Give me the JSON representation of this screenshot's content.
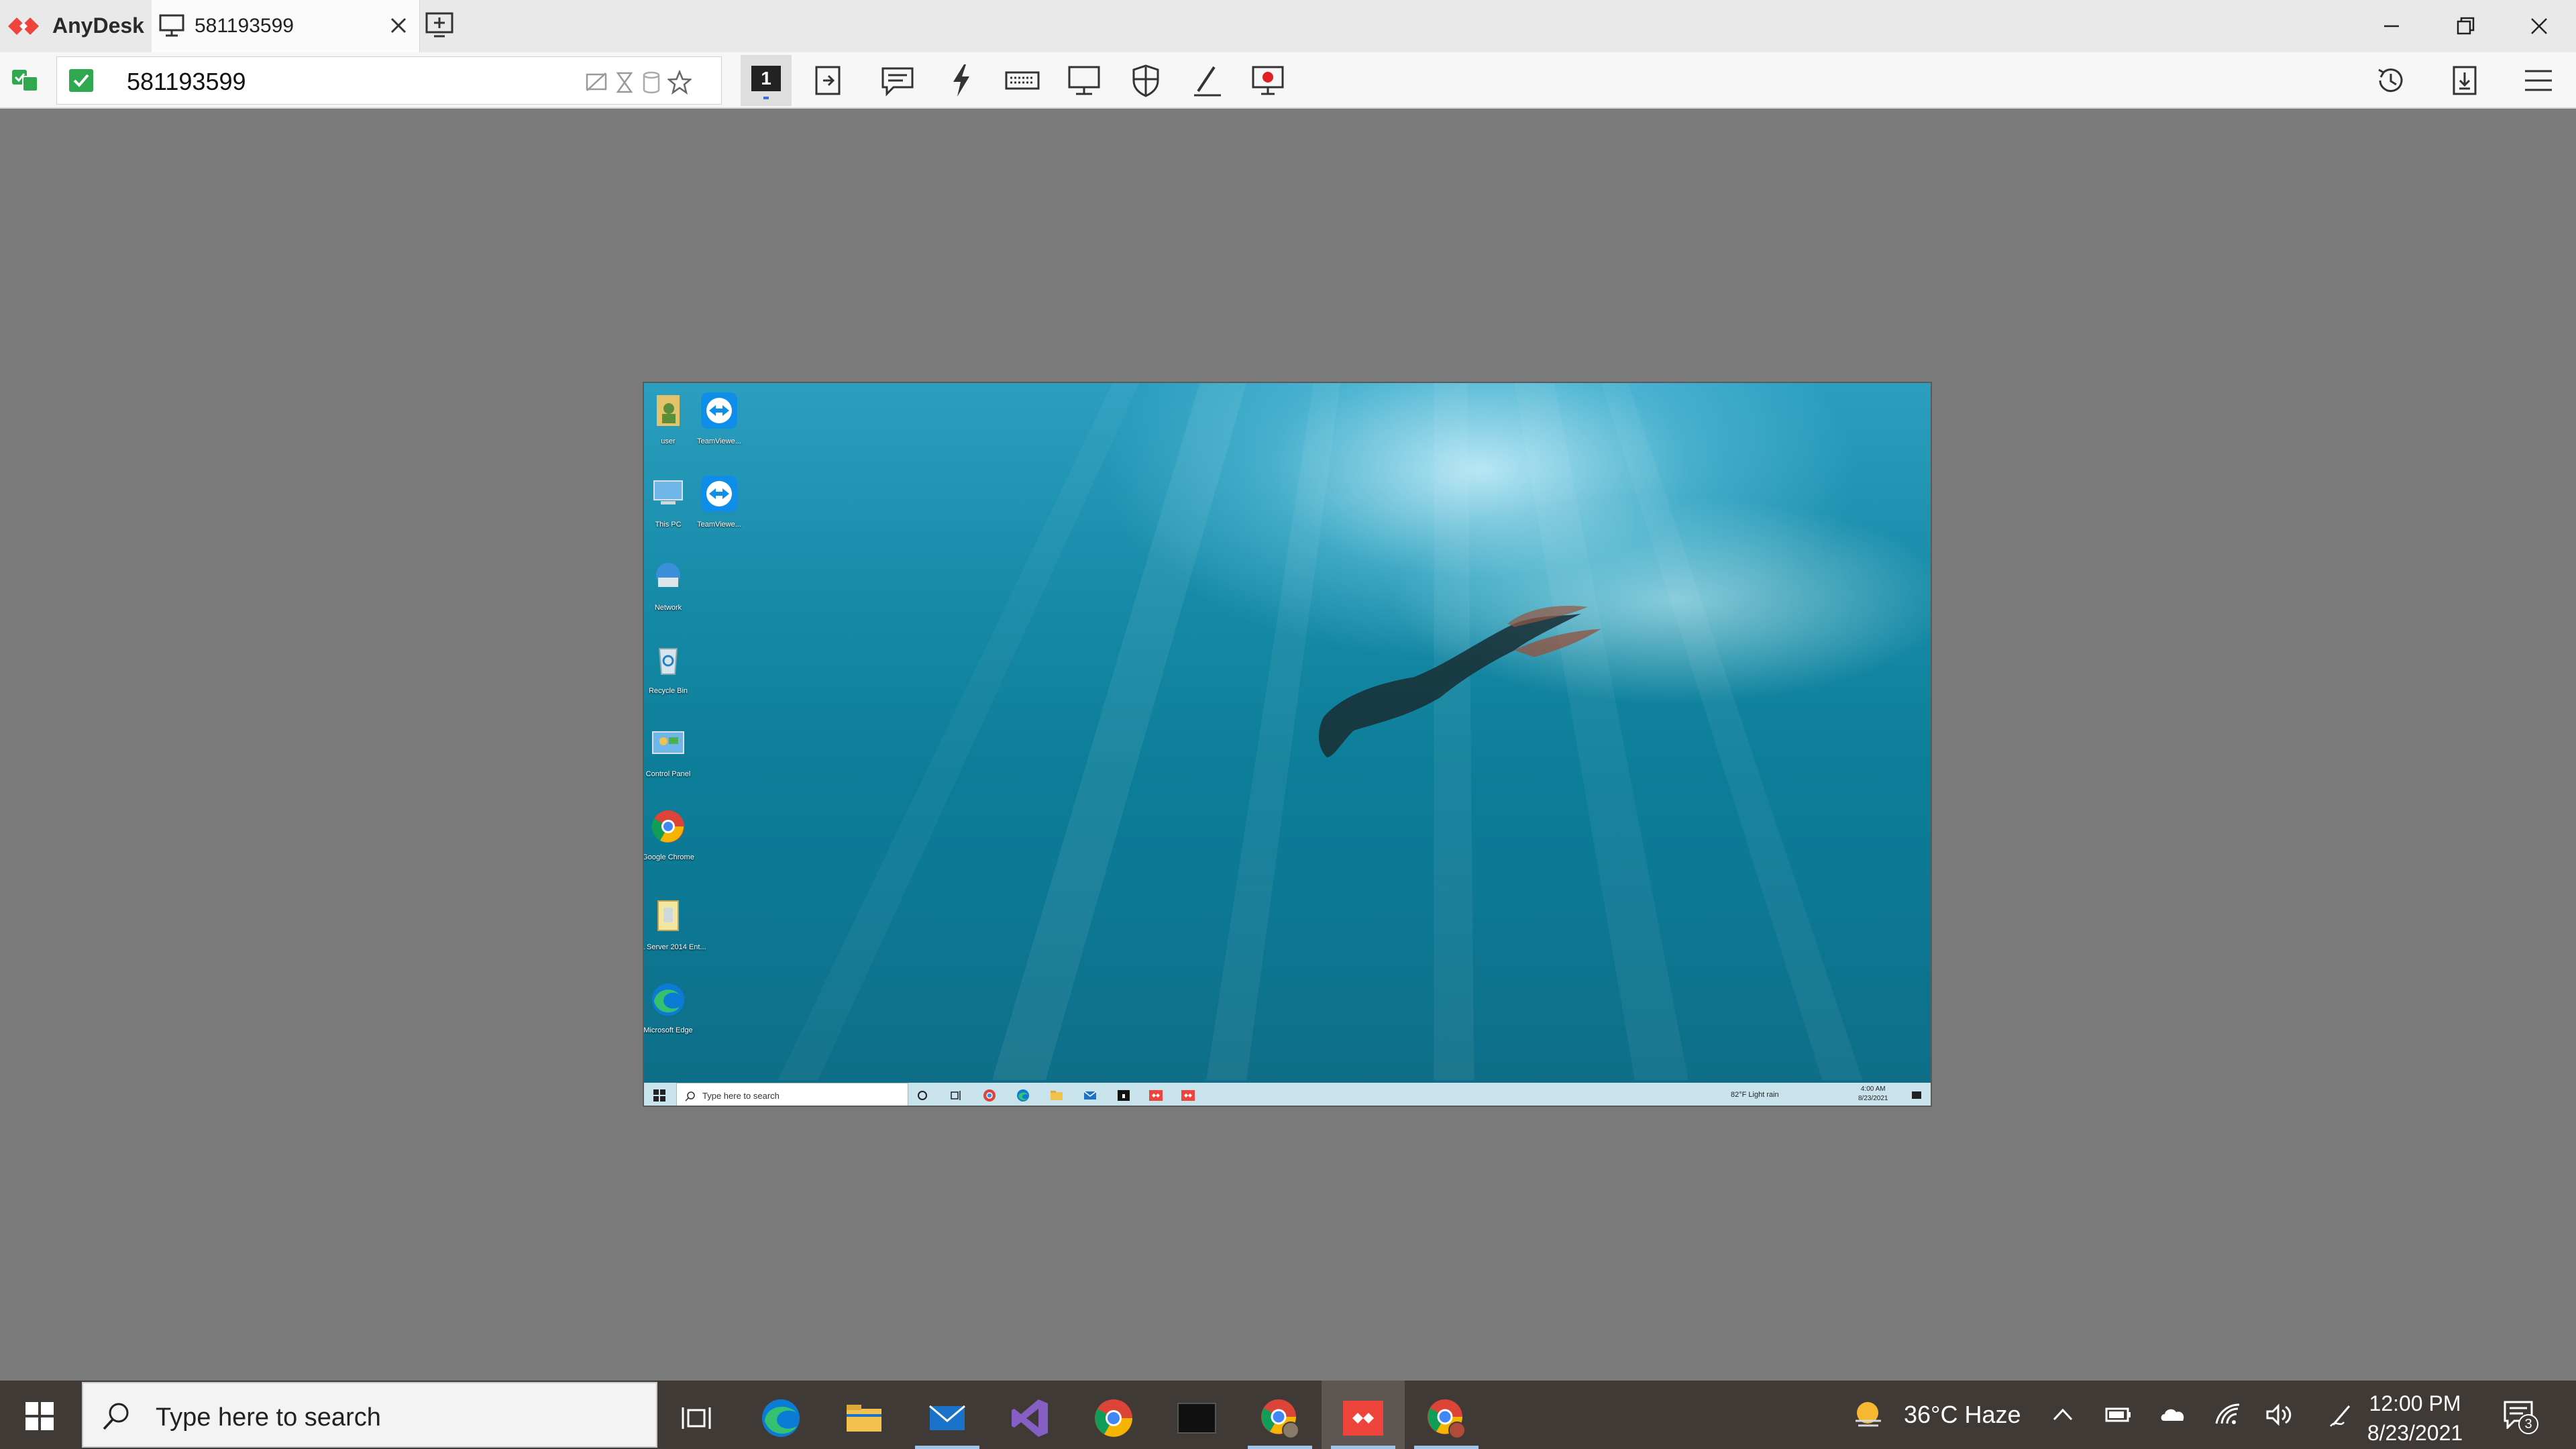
{
  "titlebar": {
    "app_name": "AnyDesk",
    "tab_label": "581193599"
  },
  "toolbar": {
    "address": "581193599",
    "screen_number": "1"
  },
  "remote": {
    "desktop_icons": [
      "user",
      "TeamViewe...",
      "This PC",
      "TeamViewe...",
      "Network",
      "Recycle Bin",
      "Control Panel",
      "Google Chrome",
      "SQL Server 2014 Ent...",
      "Microsoft Edge"
    ],
    "search_placeholder": "Type here to search",
    "weather": "82°F  Light rain",
    "time": "4:00 AM",
    "date": "8/23/2021"
  },
  "taskbar": {
    "search_placeholder": "Type here to search",
    "weather": "36°C  Haze",
    "time": "12:00 PM",
    "date": "8/23/2021",
    "notification_count": "3"
  },
  "colors": {
    "anydesk_red": "#ef443b",
    "accent_green": "#2fa84f",
    "taskbar_bg": "#403a36",
    "workspace_bg": "#7b7b7b"
  }
}
